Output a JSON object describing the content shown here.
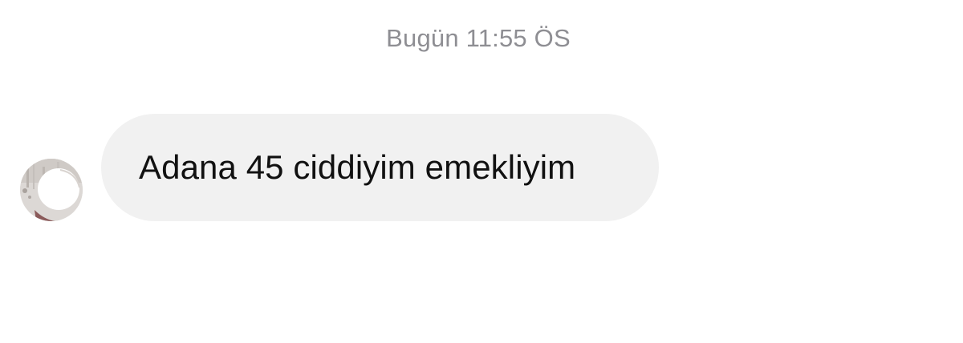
{
  "header": {
    "timestamp": "Bugün 11:55 ÖS"
  },
  "conversation": {
    "messages": [
      {
        "direction": "incoming",
        "text": "Adana 45 ciddiyim emekliyim",
        "avatar_icon": "user-avatar"
      }
    ]
  },
  "colors": {
    "background": "#ffffff",
    "bubble": "#f1f1f1",
    "timestamp": "#8e8e93",
    "text": "#111111"
  }
}
